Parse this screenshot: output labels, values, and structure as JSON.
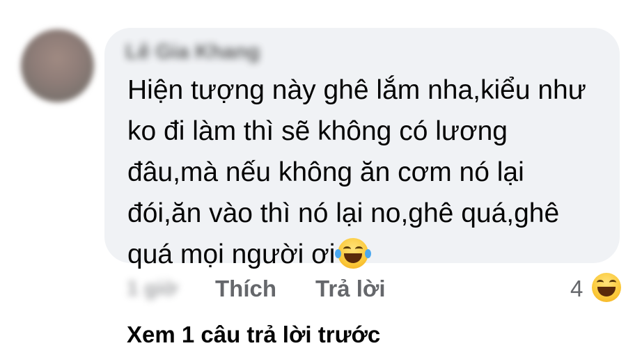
{
  "comment": {
    "author": "Lê Gia Khang",
    "text": "Hiện tượng này ghê lắm nha,kiểu như\nko đi làm thì sẽ không có lương\nđâu,mà nếu không ăn cơm nó lại\nđói,ăn vào thì nó lại no,ghê quá,ghê\nquá mọi người ơi",
    "inline_emoji": "laughing-crying-emoji",
    "time": "1 giờ"
  },
  "actions": {
    "like_label": "Thích",
    "reply_label": "Trả lời"
  },
  "reactions": {
    "count": "4",
    "icon": "laughing-face-icon"
  },
  "view_more": "Xem 1 câu trả lời trước",
  "colors": {
    "bubble": "#f0f2f5",
    "secondary_text": "#65676b",
    "primary_text": "#050505"
  }
}
